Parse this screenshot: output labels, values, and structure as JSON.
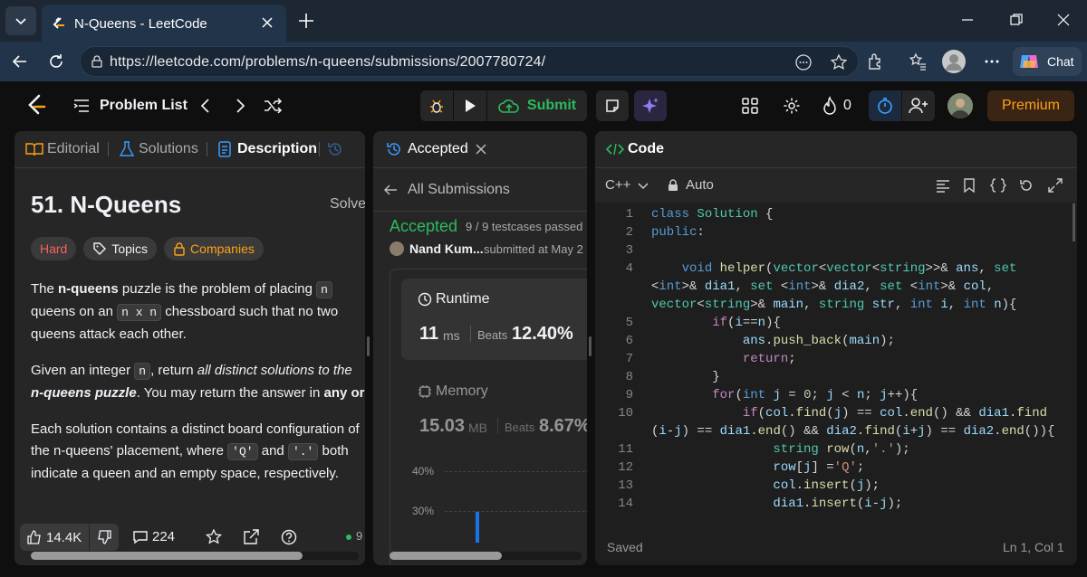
{
  "browser": {
    "tab_title": "N-Queens - LeetCode",
    "url": "https://leetcode.com/problems/n-queens/submissions/2007780724/",
    "chat_label": "Chat"
  },
  "navbar": {
    "problem_list": "Problem List",
    "submit": "Submit",
    "streak_count": "0",
    "premium": "Premium"
  },
  "left_panel": {
    "tabs": [
      "Editorial",
      "Solutions",
      "Description"
    ],
    "title": "51. N-Queens",
    "solved": "Solved",
    "difficulty": "Hard",
    "topics": "Topics",
    "companies": "Companies",
    "para1": {
      "a": "The ",
      "b": "n-queens",
      "c": " puzzle is the problem of placing ",
      "code1": "n",
      "d": " queens on an ",
      "code2": "n x n",
      "e": " chessboard such that no two queens attack each other."
    },
    "para2": {
      "a": "Given an integer ",
      "code1": "n",
      "b": ", return ",
      "c": "all distinct solutions to the ",
      "d": "n-queens puzzle",
      "e": ". You may return the answer in ",
      "f": "any order",
      "g": "."
    },
    "para3": {
      "a": "Each solution contains a distinct board configuration of the n-queens' placement, where ",
      "code1": "'Q'",
      "b": " and ",
      "code2": "'.'",
      "c": " both indicate a queen and an empty space, respectively."
    },
    "likes": "14.4K",
    "comments": "224",
    "online": "9"
  },
  "mid_panel": {
    "tab": "Accepted",
    "all_submissions": "All Submissions",
    "status": "Accepted",
    "testcases": "9 / 9 testcases passed",
    "user": "Nand Kum...",
    "submitted": "submitted at May 2",
    "runtime_label": "Runtime",
    "runtime_value": "11",
    "runtime_unit": "ms",
    "beats_label": "Beats",
    "runtime_beats": "12.40%",
    "memory_label": "Memory",
    "memory_value": "15.03",
    "memory_unit": "MB",
    "memory_beats": "8.67%",
    "chart_ticks": [
      "40%",
      "30%"
    ]
  },
  "code_panel": {
    "tab": "Code",
    "language": "C++",
    "auto": "Auto",
    "status": "Saved",
    "cursor": "Ln 1, Col 1",
    "line_numbers": [
      "1",
      "2",
      "3",
      "4",
      "5",
      "6",
      "7",
      "8",
      "9",
      "10",
      "11",
      "12",
      "13",
      "14"
    ]
  }
}
